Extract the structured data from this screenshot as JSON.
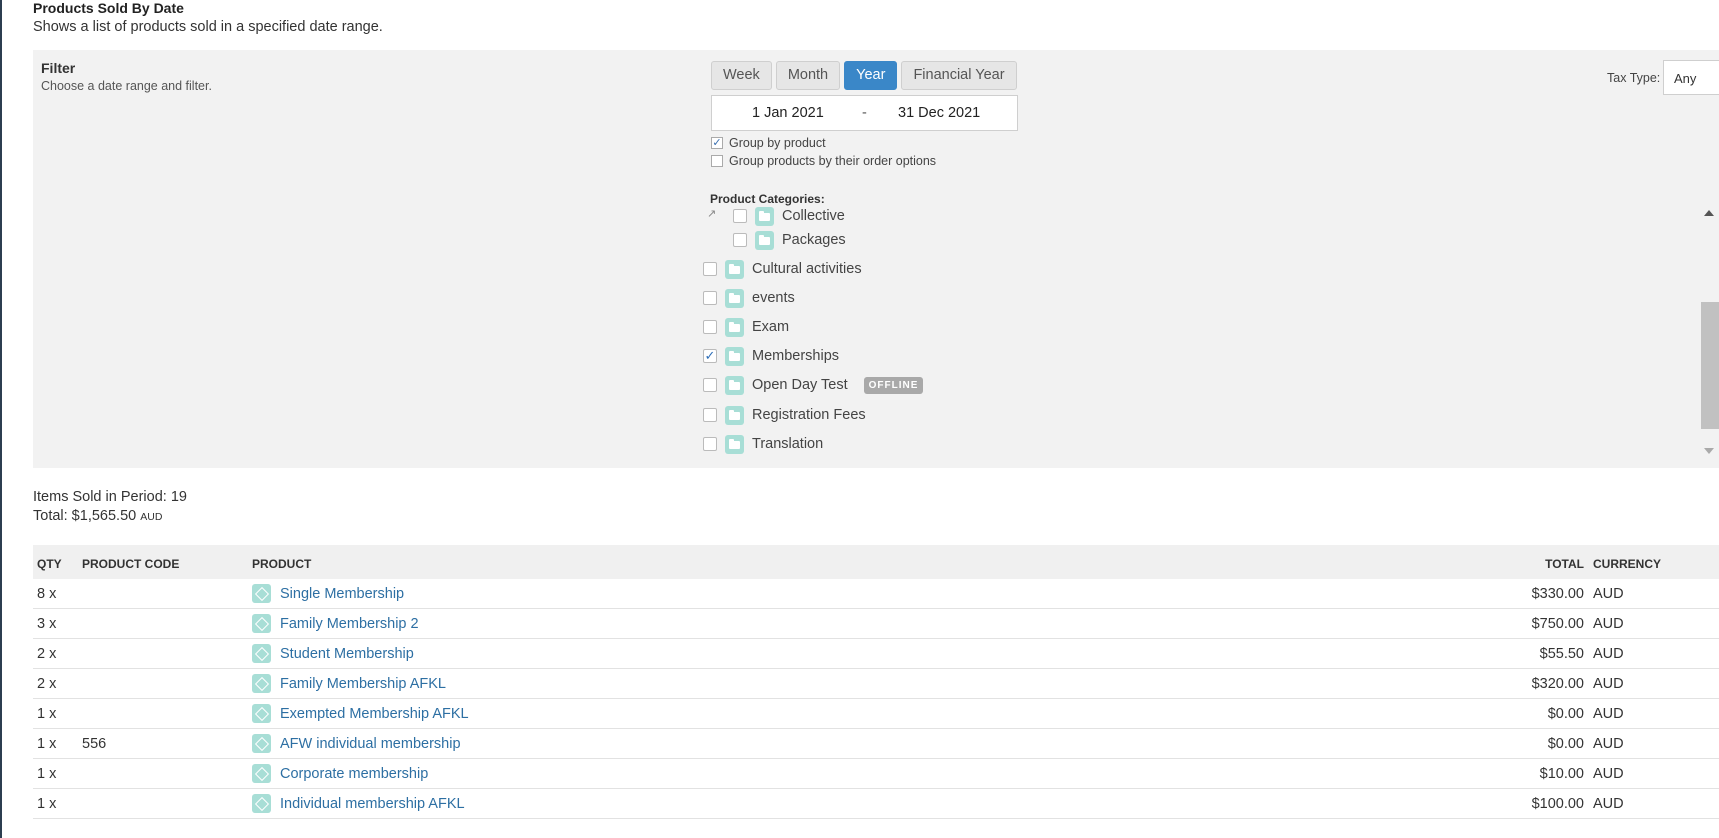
{
  "page": {
    "title": "Products Sold By Date",
    "subtitle": "Shows a list of products sold in a specified date range."
  },
  "filter": {
    "title": "Filter",
    "description": "Choose a date range and filter.",
    "periods": [
      "Week",
      "Month",
      "Year",
      "Financial Year"
    ],
    "active_period": "Year",
    "date_start": "1 Jan 2021",
    "date_separator": "-",
    "date_end": "31 Dec 2021",
    "group_by_product": {
      "label": "Group by product",
      "checked": true
    },
    "group_by_options": {
      "label": "Group products by their order options",
      "checked": false
    },
    "categories_label": "Product Categories:",
    "categories": [
      {
        "label": "Collective",
        "checked": false,
        "level": 1
      },
      {
        "label": "Packages",
        "checked": false,
        "level": 1
      },
      {
        "label": "Cultural activities",
        "checked": false,
        "level": 0
      },
      {
        "label": "events",
        "checked": false,
        "level": 0
      },
      {
        "label": "Exam",
        "checked": false,
        "level": 0
      },
      {
        "label": "Memberships",
        "checked": true,
        "level": 0
      },
      {
        "label": "Open Day Test",
        "checked": false,
        "level": 0,
        "badge": "OFFLINE"
      },
      {
        "label": "Registration Fees",
        "checked": false,
        "level": 0
      },
      {
        "label": "Translation",
        "checked": false,
        "level": 0
      }
    ],
    "tax_type_label": "Tax Type:",
    "tax_type_value": "Any"
  },
  "summary": {
    "items_sold": "Items Sold in Period: 19",
    "total_prefix": "Total: $1,565.50",
    "total_currency": "AUD"
  },
  "table": {
    "headers": {
      "qty": "QTY",
      "code": "PRODUCT CODE",
      "product": "PRODUCT",
      "total": "TOTAL",
      "currency": "CURRENCY"
    },
    "rows": [
      {
        "qty": "8 x",
        "code": "",
        "product": "Single Membership",
        "total": "$330.00",
        "currency": "AUD"
      },
      {
        "qty": "3 x",
        "code": "",
        "product": "Family Membership 2",
        "total": "$750.00",
        "currency": "AUD"
      },
      {
        "qty": "2 x",
        "code": "",
        "product": "Student Membership",
        "total": "$55.50",
        "currency": "AUD"
      },
      {
        "qty": "2 x",
        "code": "",
        "product": "Family Membership AFKL",
        "total": "$320.00",
        "currency": "AUD"
      },
      {
        "qty": "1 x",
        "code": "",
        "product": "Exempted Membership AFKL",
        "total": "$0.00",
        "currency": "AUD"
      },
      {
        "qty": "1 x",
        "code": "556",
        "product": "AFW individual membership",
        "total": "$0.00",
        "currency": "AUD"
      },
      {
        "qty": "1 x",
        "code": "",
        "product": "Corporate membership",
        "total": "$10.00",
        "currency": "AUD"
      },
      {
        "qty": "1 x",
        "code": "",
        "product": "Individual membership AFKL",
        "total": "$100.00",
        "currency": "AUD"
      }
    ]
  },
  "colors": {
    "accent": "#3a87c8",
    "link": "#2d6fa3",
    "icon_bg": "#a8ded6",
    "panel_bg": "#f2f2f2"
  }
}
